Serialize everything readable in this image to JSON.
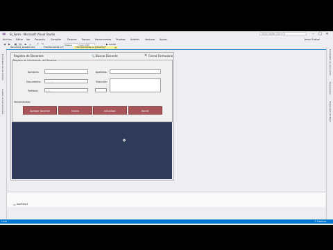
{
  "window": {
    "title": "SI_Form - Microsoft Visual Studio",
    "quick_launch": "Inicio rápido (Ctrl+Q)"
  },
  "menu": [
    "Archivo",
    "Editar",
    "Ver",
    "Proyecto",
    "Compilar",
    "Depurar",
    "Equipo",
    "Herramientas",
    "Pruebas",
    "Análisis",
    "Ventana",
    "Ayuda"
  ],
  "user": "Jesus Gustav",
  "toolbar": {
    "config": "Debug",
    "platform": "Any CPU",
    "start": "▶ Iniciar"
  },
  "left_sidebar": [
    "Explorador de servidores",
    "Cuadro de herramientas"
  ],
  "right_sidebar": [
    "Explorador de soluciones",
    "Propiedades",
    "Explorador de Team"
  ],
  "tabs": [
    "Servicios_Academico",
    "FrmDocentes.cs*",
    "FrmDocentes.cs [Diseño]*"
  ],
  "form": {
    "title": "Registro de Docentes",
    "search": "Buscar Docente",
    "close": "Cerrar Formulario",
    "group": "Registro de Información del Docente",
    "fields": {
      "nombres": "Nombres:",
      "apellidos": "Apellidos:",
      "documento": "Documento:",
      "documento_mask": "______-_",
      "direccion": "Dirección:",
      "telefono": "Teléfono:",
      "telefono_mask": "(__)-____"
    },
    "tools": "Herramientas:",
    "buttons": [
      "Agregar Docente",
      "Nuevo",
      "Actualizar",
      "Borrar"
    ]
  },
  "tray": {
    "item": "toolStrip1"
  },
  "status": {
    "left": "Listo",
    "right": "↑ Publicar"
  }
}
